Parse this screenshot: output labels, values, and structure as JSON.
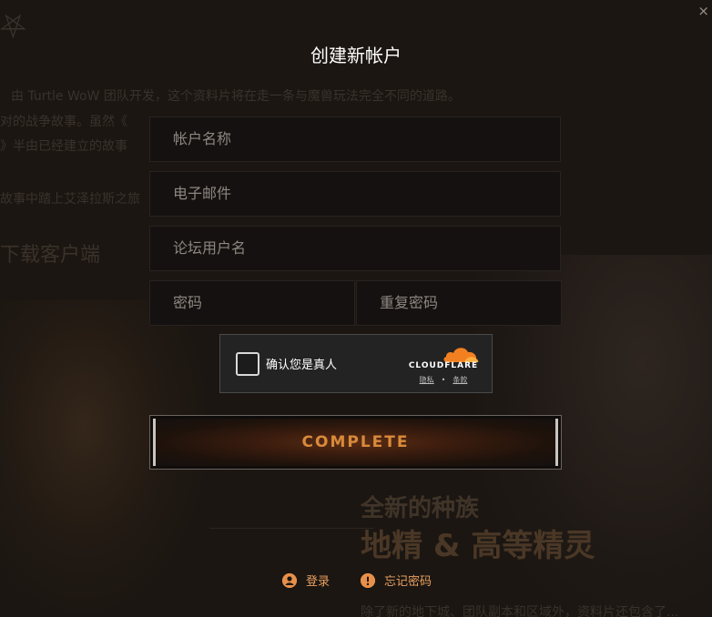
{
  "background": {
    "logo_glyph": "⛧",
    "line1": "由 Turtle WoW 团队开发，这个资料片将在走一条与魔兽玩法完全不同的道路。 ",
    "line2": "对的战争故事。虽然《",
    "line3": "》半由已经建立的故事",
    "line4": "故事中踏上艾泽拉斯之旅",
    "download": "下载客户端",
    "new_races": "全新的种族",
    "races_highlight": "地精 & 高等精灵",
    "bottom_line": "除了新的地下城、团队副本和区域外，资料片还包含了..."
  },
  "modal": {
    "close_glyph": "×",
    "title": "创建新帐户",
    "fields": {
      "account_name": {
        "placeholder": "帐户名称",
        "value": ""
      },
      "email": {
        "placeholder": "电子邮件",
        "value": ""
      },
      "forum_username": {
        "placeholder": "论坛用户名",
        "value": ""
      },
      "password": {
        "placeholder": "密码",
        "value": ""
      },
      "repeat_password": {
        "placeholder": "重复密码",
        "value": ""
      }
    },
    "captcha": {
      "label": "确认您是真人",
      "brand": "CLOUDFLARE",
      "privacy": "隐私",
      "separator": "•",
      "terms": "条款",
      "brand_color": "#f38020"
    },
    "complete_button": "COMPLETE",
    "links": {
      "login": "登录",
      "forgot_password": "忘记密码"
    },
    "colors": {
      "accent": "#e8904a",
      "button_text": "#d98a3a"
    }
  }
}
